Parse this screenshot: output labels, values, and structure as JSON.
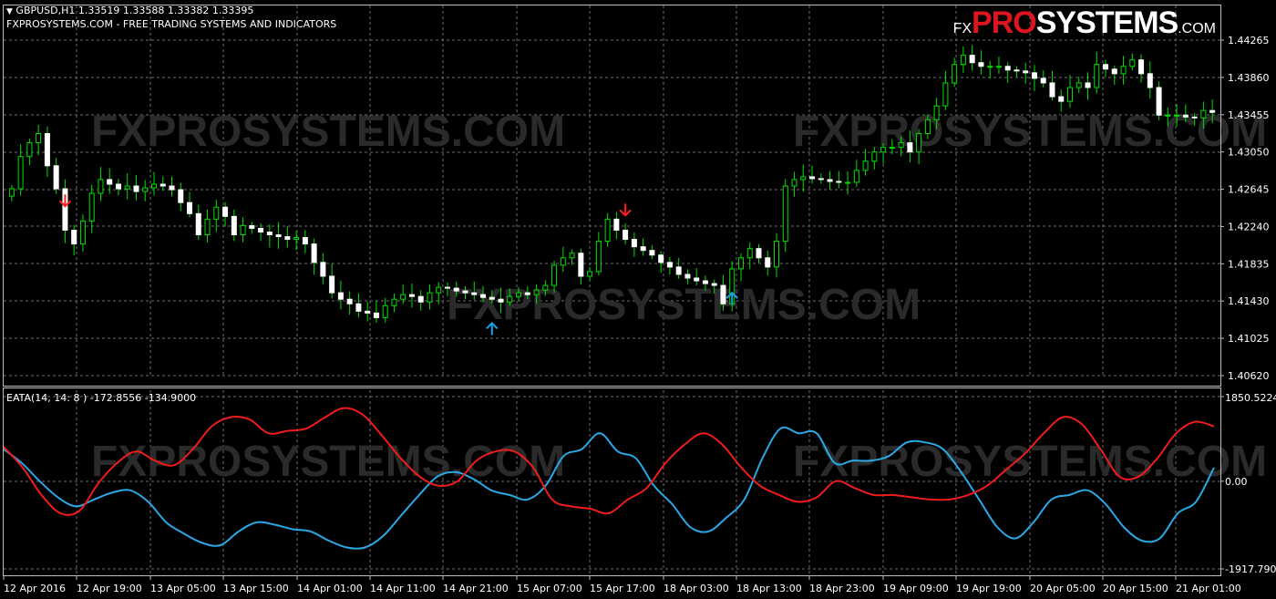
{
  "header": {
    "symbol_line": "GBPUSD,H1  1.33519 1.33588 1.33382 1.33395",
    "subtitle": "FXPROSYSTEMS.COM - FREE TRADING SYSTEMS AND INDICATORS"
  },
  "logo": {
    "fx": "FX",
    "pro": "PRO",
    "systems": "SYSTEMS",
    "com": ".COM"
  },
  "watermark": "FXPROSYSTEMS.COM",
  "indicator_label": "EATA(14, 14: 8 ) -172.8556 -134.9000",
  "colors": {
    "background": "#000000",
    "grid": "#6e6e6e",
    "bull": "#00e000",
    "bear": "#ffffff",
    "up_arrow": "#1aa3e8",
    "down_arrow": "#ff1f1f",
    "line_blue": "#2aa8e6",
    "line_red": "#ee1c1c",
    "logo_red": "#e0141e"
  },
  "chart_data": [
    {
      "type": "candlestick",
      "title": "GBPUSD,H1",
      "ylim": [
        1.4062,
        1.44265
      ],
      "yticks": [
        "1.44265",
        "1.43860",
        "1.43455",
        "1.43050",
        "1.42645",
        "1.42240",
        "1.41835",
        "1.41430",
        "1.41025",
        "1.40620"
      ],
      "xticks": [
        "12 Apr 2016",
        "12 Apr 19:00",
        "13 Apr 05:00",
        "13 Apr 15:00",
        "14 Apr 01:00",
        "14 Apr 11:00",
        "14 Apr 21:00",
        "15 Apr 07:00",
        "15 Apr 17:00",
        "18 Apr 03:00",
        "18 Apr 13:00",
        "18 Apr 23:00",
        "19 Apr 09:00",
        "19 Apr 19:00",
        "20 Apr 05:00",
        "20 Apr 15:00",
        "21 Apr 01:00"
      ],
      "grid": true,
      "close": [
        1.4265,
        1.43,
        1.4315,
        1.4325,
        1.429,
        1.4265,
        1.422,
        1.4205,
        1.423,
        1.426,
        1.4275,
        1.427,
        1.4265,
        1.4268,
        1.4262,
        1.4266,
        1.427,
        1.4268,
        1.4264,
        1.425,
        1.4238,
        1.4215,
        1.4232,
        1.4245,
        1.4235,
        1.4215,
        1.4225,
        1.4222,
        1.4218,
        1.4215,
        1.4213,
        1.421,
        1.4212,
        1.4205,
        1.4185,
        1.417,
        1.4152,
        1.4145,
        1.414,
        1.4132,
        1.413,
        1.4125,
        1.4138,
        1.4145,
        1.415,
        1.4148,
        1.4142,
        1.4152,
        1.4158,
        1.4157,
        1.4154,
        1.4152,
        1.415,
        1.4147,
        1.4145,
        1.4142,
        1.4148,
        1.4152,
        1.415,
        1.4155,
        1.416,
        1.4182,
        1.419,
        1.4195,
        1.417,
        1.4175,
        1.4208,
        1.4232,
        1.422,
        1.421,
        1.4202,
        1.4198,
        1.4193,
        1.4185,
        1.418,
        1.4172,
        1.4168,
        1.4165,
        1.4162,
        1.416,
        1.414,
        1.4178,
        1.419,
        1.42,
        1.419,
        1.418,
        1.4208,
        1.4268,
        1.4275,
        1.4278,
        1.4276,
        1.4275,
        1.4273,
        1.4272,
        1.4272,
        1.4285,
        1.4295,
        1.4305,
        1.431,
        1.431,
        1.4315,
        1.4305,
        1.4325,
        1.434,
        1.4355,
        1.438,
        1.44,
        1.441,
        1.4402,
        1.4398,
        1.4398,
        1.4398,
        1.4394,
        1.4393,
        1.4391,
        1.4385,
        1.438,
        1.4365,
        1.436,
        1.4375,
        1.438,
        1.4375,
        1.44,
        1.4395,
        1.439,
        1.4398,
        1.4405,
        1.439,
        1.4375,
        1.4345,
        1.4345,
        1.4345,
        1.4343,
        1.4342,
        1.435,
        1.4348
      ],
      "markers": [
        {
          "type": "down",
          "at_candle": 6,
          "label": "sell"
        },
        {
          "type": "up",
          "at_candle": 54,
          "label": "buy"
        },
        {
          "type": "down",
          "at_candle": 69,
          "label": "sell"
        },
        {
          "type": "up",
          "at_candle": 81,
          "label": "buy"
        }
      ]
    },
    {
      "type": "line",
      "title": "EATA(14, 14: 8 ) -172.8556 -134.9000",
      "ylim": [
        -1917.7902,
        1850.5224
      ],
      "yticks": [
        "1850.5224",
        "0.00",
        "-1917.7902"
      ],
      "grid": true,
      "series": [
        {
          "color": "#2aa8e6",
          "values": [
            700,
            400,
            0,
            -350,
            -550,
            -400,
            -250,
            -200,
            -450,
            -900,
            -1150,
            -1350,
            -1400,
            -1100,
            -900,
            -950,
            -1050,
            -1100,
            -1300,
            -1450,
            -1450,
            -1200,
            -750,
            -300,
            100,
            200,
            50,
            -200,
            -300,
            -400,
            -100,
            550,
            700,
            1050,
            650,
            500,
            -100,
            -500,
            -1000,
            -1100,
            -800,
            -400,
            500,
            1150,
            1050,
            1050,
            400,
            450,
            450,
            550,
            850,
            850,
            700,
            200,
            -400,
            -1000,
            -1250,
            -900,
            -400,
            -300,
            -200,
            -500,
            -1000,
            -1300,
            -1250,
            -700,
            -450,
            300
          ]
        },
        {
          "color": "#ee1c1c",
          "values": [
            750,
            300,
            -300,
            -700,
            -650,
            -50,
            400,
            650,
            450,
            350,
            700,
            1200,
            1400,
            1350,
            1050,
            1100,
            1150,
            1400,
            1600,
            1450,
            1000,
            500,
            100,
            -100,
            0,
            450,
            650,
            650,
            300,
            -400,
            -550,
            -600,
            -700,
            -400,
            -150,
            400,
            800,
            1050,
            800,
            300,
            -100,
            -300,
            -450,
            -350,
            0,
            -150,
            -300,
            -300,
            -350,
            -400,
            -400,
            -300,
            -100,
            250,
            600,
            1050,
            1400,
            1250,
            700,
            100,
            100,
            500,
            1050,
            1300,
            1200
          ]
        }
      ]
    }
  ]
}
